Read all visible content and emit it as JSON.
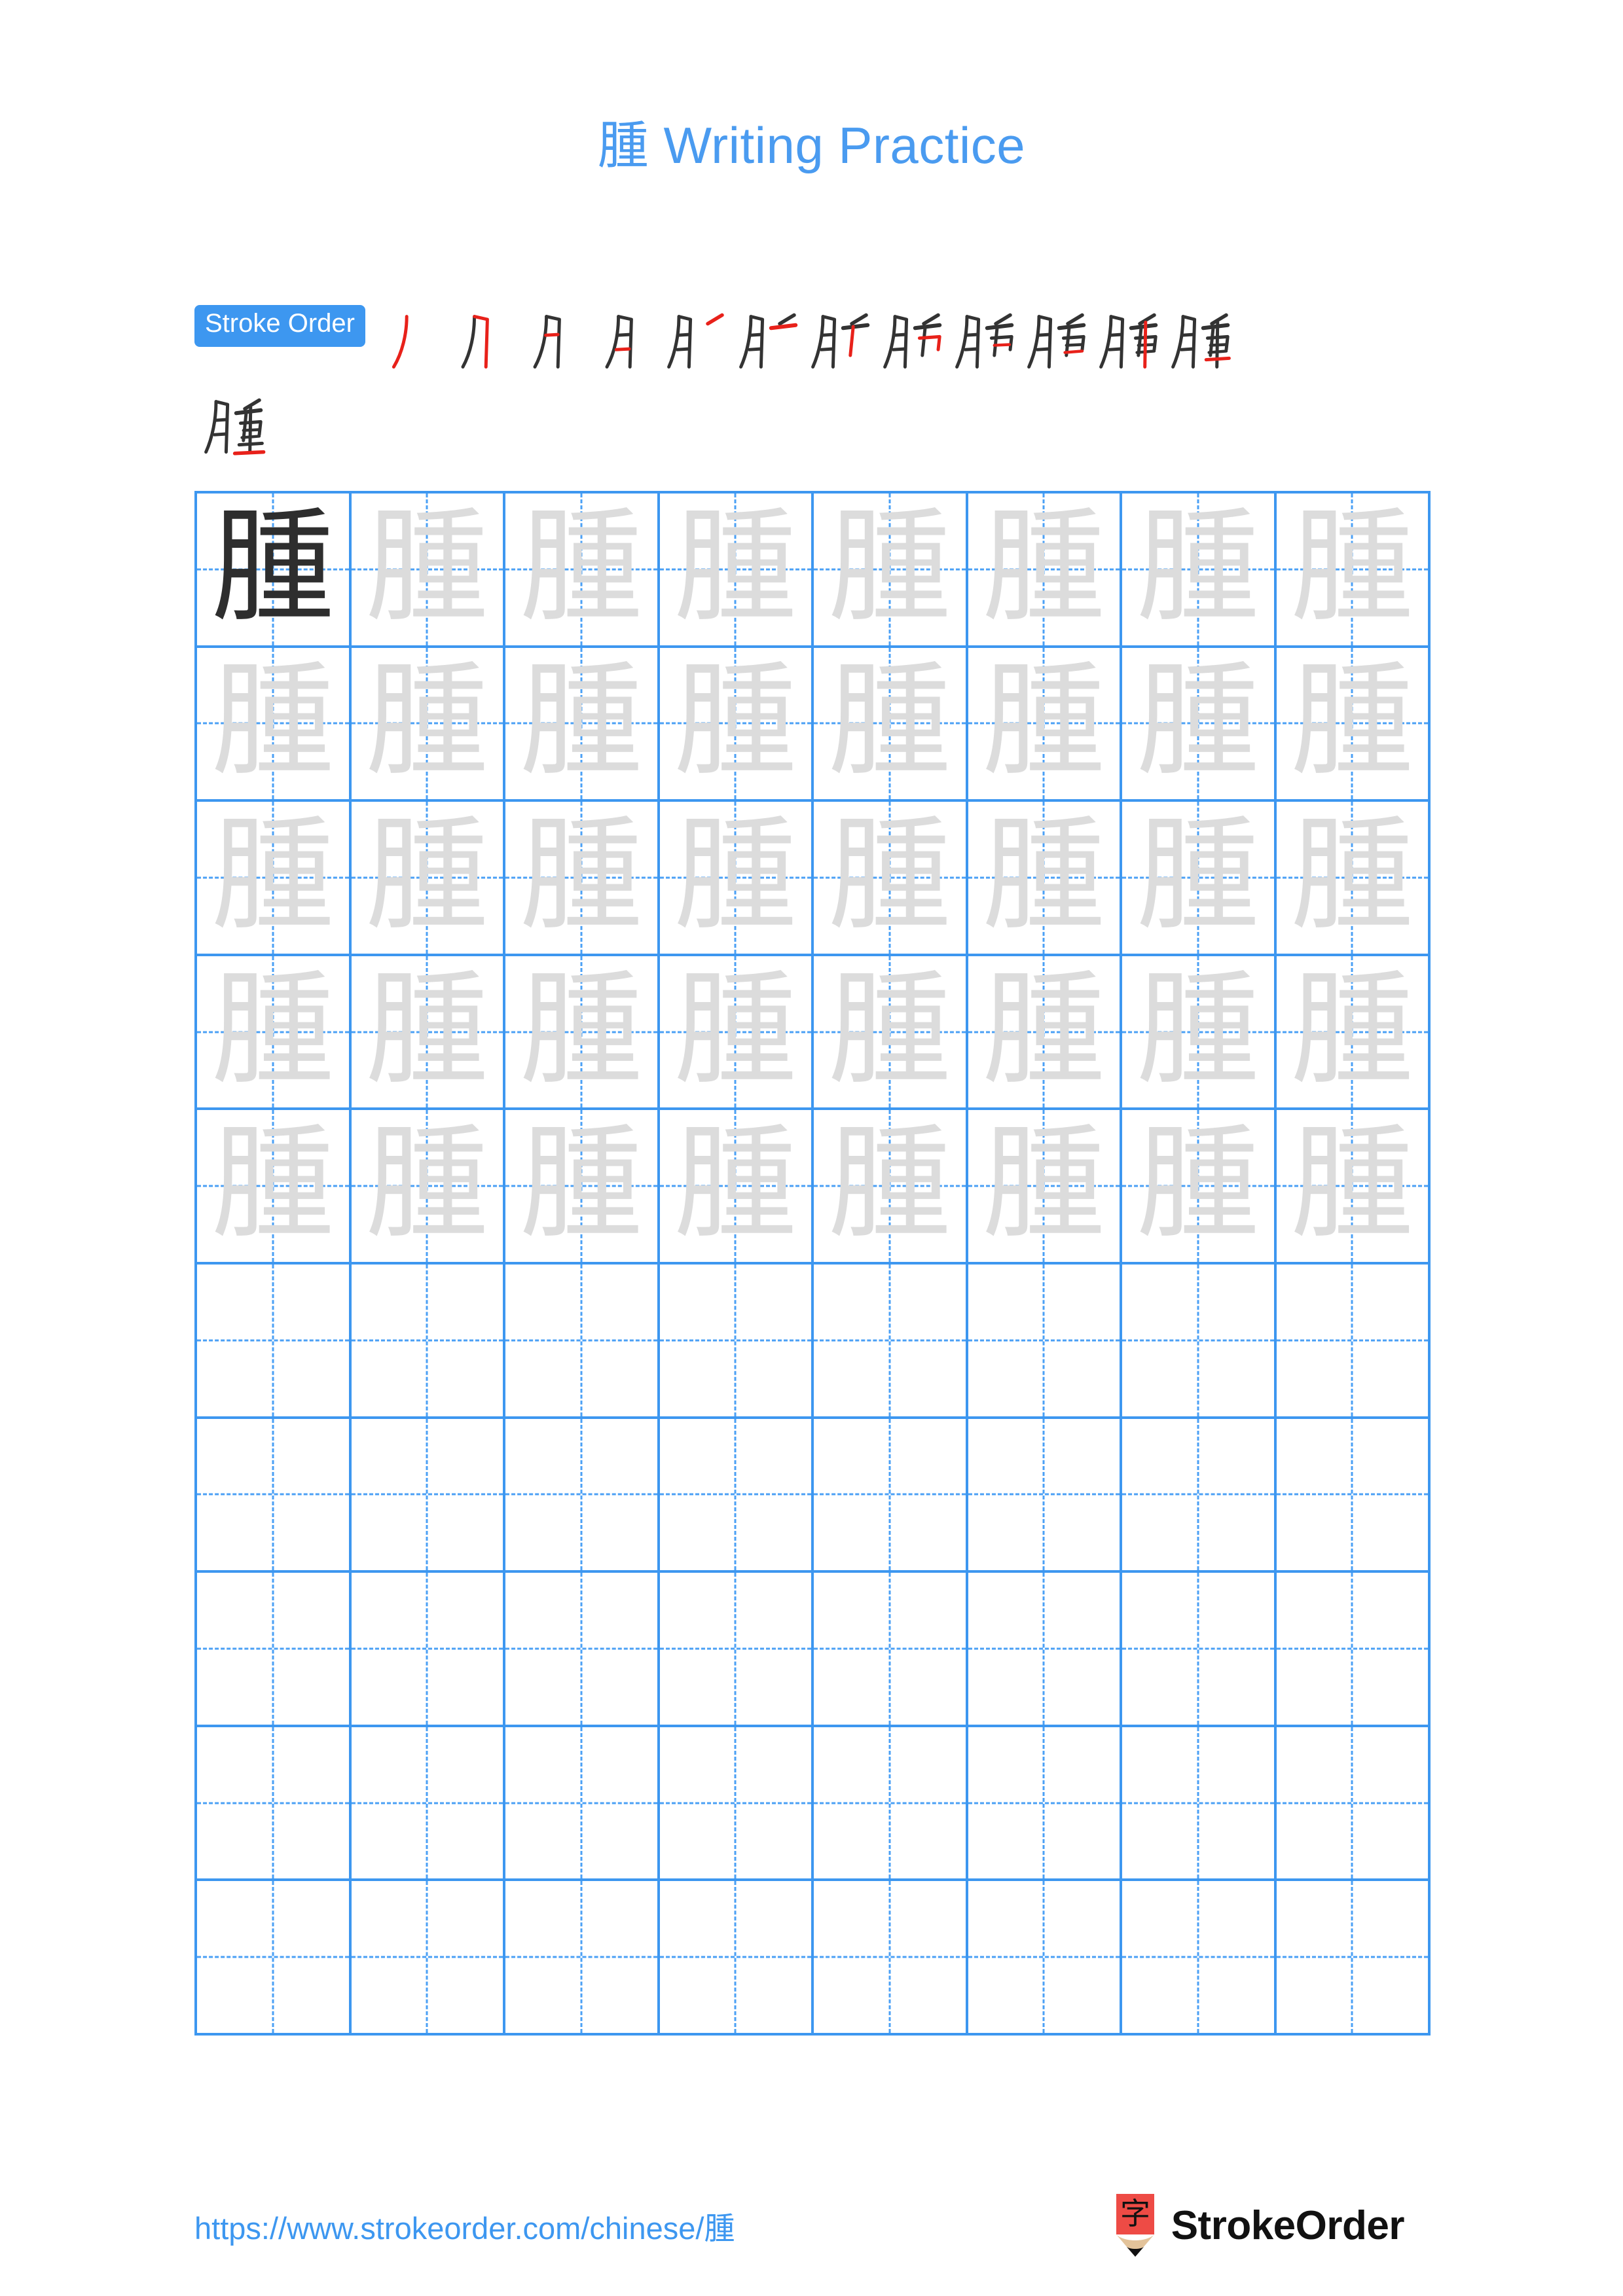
{
  "page": {
    "character": "腫",
    "title_suffix": " Writing Practice",
    "title_full": "腫 Writing Practice"
  },
  "stroke_order": {
    "badge_label": "Stroke Order",
    "total_strokes": 13,
    "badge_bg": "#3d97f0",
    "badge_text_color": "#ffffff",
    "new_stroke_color": "#e8211a",
    "existing_stroke_color": "#333333",
    "steps": [
      {
        "index": 1,
        "label": "丿"
      },
      {
        "index": 2,
        "label": "刀"
      },
      {
        "index": 3,
        "label": "月"
      },
      {
        "index": 4,
        "label": "月"
      },
      {
        "index": 5,
        "label": "月丿"
      },
      {
        "index": 6,
        "label": "月一"
      },
      {
        "index": 7,
        "label": "月丨"
      },
      {
        "index": 8,
        "label": "月𠃍"
      },
      {
        "index": 9,
        "label": "月一"
      },
      {
        "index": 10,
        "label": "月二"
      },
      {
        "index": 11,
        "label": "月丨"
      },
      {
        "index": 12,
        "label": "月二"
      },
      {
        "index": 13,
        "label": "腫"
      }
    ]
  },
  "grid": {
    "columns": 8,
    "rows": 10,
    "filled_rows": 5,
    "model_cell_index": 0,
    "trace_character": "腫",
    "model_color": "#2e2e2e",
    "trace_color": "#dcdcdc",
    "line_color": "#3d97f0",
    "guide_color": "#4ba0f5"
  },
  "footer": {
    "url": "https://www.strokeorder.com/chinese/腫",
    "brand_name": "StrokeOrder",
    "brand_logo_char": "字",
    "brand_logo_color": "#ee4b45"
  },
  "colors": {
    "accent": "#4a9bf0",
    "grid_line": "#3d97f0",
    "trace_gray": "#dcdcdc",
    "ink": "#2e2e2e",
    "red": "#e8211a",
    "background": "#ffffff"
  }
}
